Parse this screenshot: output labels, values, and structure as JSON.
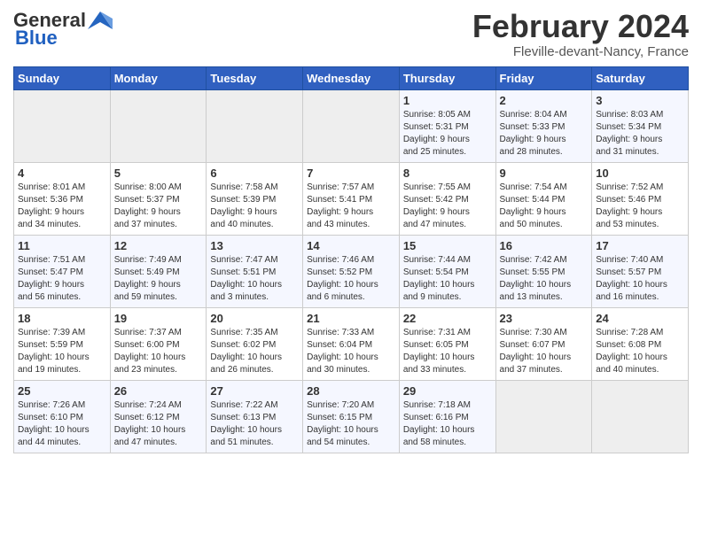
{
  "header": {
    "logo_general": "General",
    "logo_blue": "Blue",
    "title": "February 2024",
    "location": "Fleville-devant-Nancy, France"
  },
  "days_of_week": [
    "Sunday",
    "Monday",
    "Tuesday",
    "Wednesday",
    "Thursday",
    "Friday",
    "Saturday"
  ],
  "weeks": [
    [
      {
        "day": "",
        "content": ""
      },
      {
        "day": "",
        "content": ""
      },
      {
        "day": "",
        "content": ""
      },
      {
        "day": "",
        "content": ""
      },
      {
        "day": "1",
        "content": "Sunrise: 8:05 AM\nSunset: 5:31 PM\nDaylight: 9 hours\nand 25 minutes."
      },
      {
        "day": "2",
        "content": "Sunrise: 8:04 AM\nSunset: 5:33 PM\nDaylight: 9 hours\nand 28 minutes."
      },
      {
        "day": "3",
        "content": "Sunrise: 8:03 AM\nSunset: 5:34 PM\nDaylight: 9 hours\nand 31 minutes."
      }
    ],
    [
      {
        "day": "4",
        "content": "Sunrise: 8:01 AM\nSunset: 5:36 PM\nDaylight: 9 hours\nand 34 minutes."
      },
      {
        "day": "5",
        "content": "Sunrise: 8:00 AM\nSunset: 5:37 PM\nDaylight: 9 hours\nand 37 minutes."
      },
      {
        "day": "6",
        "content": "Sunrise: 7:58 AM\nSunset: 5:39 PM\nDaylight: 9 hours\nand 40 minutes."
      },
      {
        "day": "7",
        "content": "Sunrise: 7:57 AM\nSunset: 5:41 PM\nDaylight: 9 hours\nand 43 minutes."
      },
      {
        "day": "8",
        "content": "Sunrise: 7:55 AM\nSunset: 5:42 PM\nDaylight: 9 hours\nand 47 minutes."
      },
      {
        "day": "9",
        "content": "Sunrise: 7:54 AM\nSunset: 5:44 PM\nDaylight: 9 hours\nand 50 minutes."
      },
      {
        "day": "10",
        "content": "Sunrise: 7:52 AM\nSunset: 5:46 PM\nDaylight: 9 hours\nand 53 minutes."
      }
    ],
    [
      {
        "day": "11",
        "content": "Sunrise: 7:51 AM\nSunset: 5:47 PM\nDaylight: 9 hours\nand 56 minutes."
      },
      {
        "day": "12",
        "content": "Sunrise: 7:49 AM\nSunset: 5:49 PM\nDaylight: 9 hours\nand 59 minutes."
      },
      {
        "day": "13",
        "content": "Sunrise: 7:47 AM\nSunset: 5:51 PM\nDaylight: 10 hours\nand 3 minutes."
      },
      {
        "day": "14",
        "content": "Sunrise: 7:46 AM\nSunset: 5:52 PM\nDaylight: 10 hours\nand 6 minutes."
      },
      {
        "day": "15",
        "content": "Sunrise: 7:44 AM\nSunset: 5:54 PM\nDaylight: 10 hours\nand 9 minutes."
      },
      {
        "day": "16",
        "content": "Sunrise: 7:42 AM\nSunset: 5:55 PM\nDaylight: 10 hours\nand 13 minutes."
      },
      {
        "day": "17",
        "content": "Sunrise: 7:40 AM\nSunset: 5:57 PM\nDaylight: 10 hours\nand 16 minutes."
      }
    ],
    [
      {
        "day": "18",
        "content": "Sunrise: 7:39 AM\nSunset: 5:59 PM\nDaylight: 10 hours\nand 19 minutes."
      },
      {
        "day": "19",
        "content": "Sunrise: 7:37 AM\nSunset: 6:00 PM\nDaylight: 10 hours\nand 23 minutes."
      },
      {
        "day": "20",
        "content": "Sunrise: 7:35 AM\nSunset: 6:02 PM\nDaylight: 10 hours\nand 26 minutes."
      },
      {
        "day": "21",
        "content": "Sunrise: 7:33 AM\nSunset: 6:04 PM\nDaylight: 10 hours\nand 30 minutes."
      },
      {
        "day": "22",
        "content": "Sunrise: 7:31 AM\nSunset: 6:05 PM\nDaylight: 10 hours\nand 33 minutes."
      },
      {
        "day": "23",
        "content": "Sunrise: 7:30 AM\nSunset: 6:07 PM\nDaylight: 10 hours\nand 37 minutes."
      },
      {
        "day": "24",
        "content": "Sunrise: 7:28 AM\nSunset: 6:08 PM\nDaylight: 10 hours\nand 40 minutes."
      }
    ],
    [
      {
        "day": "25",
        "content": "Sunrise: 7:26 AM\nSunset: 6:10 PM\nDaylight: 10 hours\nand 44 minutes."
      },
      {
        "day": "26",
        "content": "Sunrise: 7:24 AM\nSunset: 6:12 PM\nDaylight: 10 hours\nand 47 minutes."
      },
      {
        "day": "27",
        "content": "Sunrise: 7:22 AM\nSunset: 6:13 PM\nDaylight: 10 hours\nand 51 minutes."
      },
      {
        "day": "28",
        "content": "Sunrise: 7:20 AM\nSunset: 6:15 PM\nDaylight: 10 hours\nand 54 minutes."
      },
      {
        "day": "29",
        "content": "Sunrise: 7:18 AM\nSunset: 6:16 PM\nDaylight: 10 hours\nand 58 minutes."
      },
      {
        "day": "",
        "content": ""
      },
      {
        "day": "",
        "content": ""
      }
    ]
  ]
}
